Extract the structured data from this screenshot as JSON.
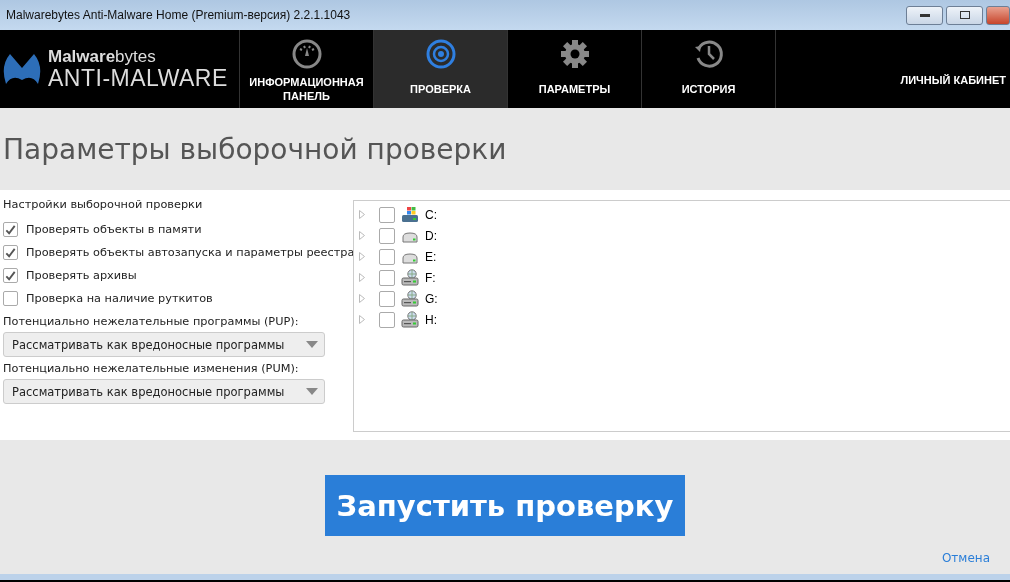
{
  "window": {
    "title": "Malwarebytes Anti-Malware Home (Premium-версия) 2.2.1.1043"
  },
  "logo": {
    "brand_light": "Malware",
    "brand_thin": "bytes",
    "product": "ANTI-MALWARE"
  },
  "tabs": [
    {
      "label": "ИНФОРМАЦИОННАЯ ПАНЕЛЬ",
      "kind": "gauge",
      "selected": false
    },
    {
      "label": "ПРОВЕРКА",
      "kind": "target",
      "selected": true
    },
    {
      "label": "ПАРАМЕТРЫ",
      "kind": "gear",
      "selected": false
    },
    {
      "label": "ИСТОРИЯ",
      "kind": "history",
      "selected": false
    }
  ],
  "account_link": "ЛИЧНЫЙ КАБИНЕТ",
  "page_title": "Параметры выборочной проверки",
  "settings": {
    "heading": "Настройки выборочной проверки",
    "options": [
      {
        "label": "Проверять объекты в памяти",
        "checked": true
      },
      {
        "label": "Проверять объекты автозапуска и параметры реестра",
        "checked": true
      },
      {
        "label": "Проверять архивы",
        "checked": true
      },
      {
        "label": "Проверка на наличие руткитов",
        "checked": false
      }
    ],
    "dropdowns": [
      {
        "label": "Потенциально нежелательные программы (PUP):",
        "value": "Рассматривать как вредоносные программы"
      },
      {
        "label": "Потенциально нежелательные изменения (PUM):",
        "value": "Рассматривать как вредоносные программы"
      }
    ]
  },
  "drives": [
    {
      "label": "C:",
      "kind": "system",
      "checked": false
    },
    {
      "label": "D:",
      "kind": "disk",
      "checked": false
    },
    {
      "label": "E:",
      "kind": "disk",
      "checked": false
    },
    {
      "label": "F:",
      "kind": "network",
      "checked": false
    },
    {
      "label": "G:",
      "kind": "network",
      "checked": false
    },
    {
      "label": "H:",
      "kind": "network",
      "checked": false
    }
  ],
  "start_button": "Запустить проверку",
  "cancel_link": "Отмена"
}
